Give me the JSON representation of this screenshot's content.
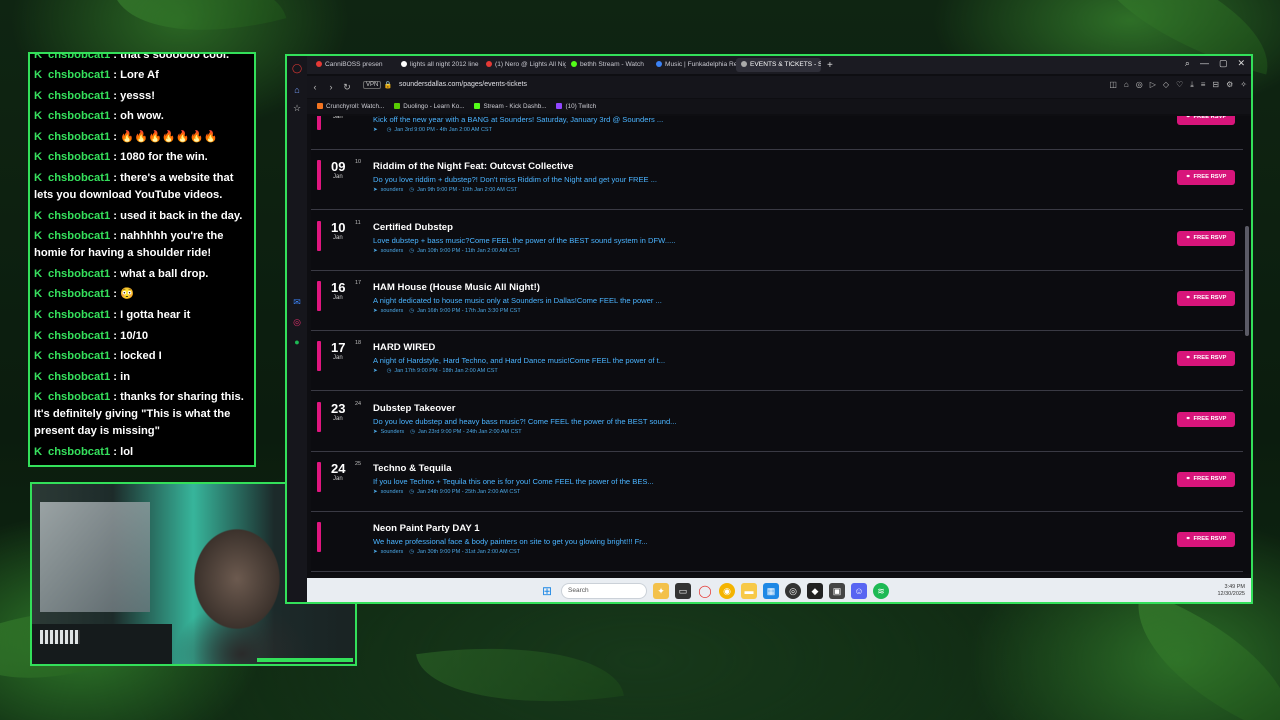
{
  "chat": {
    "messages": [
      {
        "user": "chsbobcat1",
        "text": ": that's soooooo cool."
      },
      {
        "user": "chsbobcat1",
        "text": ": Lore Af"
      },
      {
        "user": "chsbobcat1",
        "text": ": yesss!"
      },
      {
        "user": "chsbobcat1",
        "text": ": oh wow."
      },
      {
        "user": "chsbobcat1",
        "text": ": 🔥🔥🔥🔥🔥🔥🔥"
      },
      {
        "user": "chsbobcat1",
        "text": ": 1080 for the win."
      },
      {
        "user": "chsbobcat1",
        "text": ": there's a website that lets you download YouTube videos."
      },
      {
        "user": "chsbobcat1",
        "text": ": used it back in the day."
      },
      {
        "user": "chsbobcat1",
        "text": ": nahhhhh you're the homie for having a shoulder ride!"
      },
      {
        "user": "chsbobcat1",
        "text": ": what a ball drop."
      },
      {
        "user": "chsbobcat1",
        "text": ": 😳"
      },
      {
        "user": "chsbobcat1",
        "text": ": I gotta hear it"
      },
      {
        "user": "chsbobcat1",
        "text": ": 10/10"
      },
      {
        "user": "chsbobcat1",
        "text": ": locked I"
      },
      {
        "user": "chsbobcat1",
        "text": ": in"
      },
      {
        "user": "chsbobcat1",
        "text": ": thanks for sharing this. It's definitely giving \"This is what the present day is missing\""
      },
      {
        "user": "chsbobcat1",
        "text": ": lol"
      }
    ],
    "badge_glyph": "K"
  },
  "browser": {
    "tabs": [
      {
        "label": "CanniBOSS presen",
        "color": "#e53935"
      },
      {
        "label": "lights all night 2012 line",
        "color": "#ffffff"
      },
      {
        "label": "(1) Nero @ Lights All Nig",
        "color": "#e53935"
      },
      {
        "label": "bethh Stream - Watch",
        "color": "#53fc18"
      },
      {
        "label": "Music | Funkadelphia Rec",
        "color": "#3b82f6"
      },
      {
        "label": "EVENTS & TICKETS - Sou",
        "color": "#aaaaaa",
        "active": true
      }
    ],
    "new_tab": "+",
    "url": "soundersdallas.com/pages/events-tickets",
    "vpn": "VPN",
    "bookmarks": [
      {
        "label": "Crunchyroll: Watch...",
        "color": "#f47521"
      },
      {
        "label": "Duolingo - Learn Ko...",
        "color": "#58cc02"
      },
      {
        "label": "Stream - Kick Dashb...",
        "color": "#53fc18"
      },
      {
        "label": "(10) Twitch",
        "color": "#9146ff"
      }
    ],
    "taskbar": {
      "search_placeholder": "Search",
      "time": "3:49 PM",
      "date": "12/30/2025"
    }
  },
  "events": [
    {
      "day": "",
      "day2": "",
      "mon": "Jan",
      "title": "",
      "desc": "Kick off the new year with a BANG at Sounders! Saturday, January 3rd @ Sounders ...",
      "meta": "Jan 3rd 9:00 PM - 4th Jan 2:00 AM CST",
      "venue": "",
      "rsvp": "FREE RSVP"
    },
    {
      "day": "09",
      "day2": "10",
      "mon": "Jan",
      "title": "Riddim of the Night Feat: Outcvst Collective",
      "desc": "Do you love riddim + dubstep?! Don't miss Riddim of the Night and get your FREE ...",
      "meta": "Jan 9th 9:00 PM - 10th Jan 2:00 AM CST",
      "venue": "sounders",
      "rsvp": "FREE RSVP"
    },
    {
      "day": "10",
      "day2": "11",
      "mon": "Jan",
      "title": "Certified Dubstep",
      "desc": "Love dubstep + bass music?Come FEEL the power of the BEST sound system in DFW.....",
      "meta": "Jan 10th 9:00 PM - 11th Jan 2:00 AM CST",
      "venue": "sounders",
      "rsvp": "FREE RSVP"
    },
    {
      "day": "16",
      "day2": "17",
      "mon": "Jan",
      "title": "HAM House (House Music All Night!)",
      "desc": "A night dedicated to house music only at Sounders in Dallas!Come FEEL the power ...",
      "meta": "Jan 16th 9:00 PM - 17th Jan 3:30 PM CST",
      "venue": "sounders",
      "rsvp": "FREE RSVP"
    },
    {
      "day": "17",
      "day2": "18",
      "mon": "Jan",
      "title": "HARD WIRED",
      "desc": "A night of Hardstyle, Hard Techno, and Hard Dance music!Come FEEL the power of t...",
      "meta": "Jan 17th 9:00 PM - 18th Jan 2:00 AM CST",
      "venue": "",
      "rsvp": "FREE RSVP"
    },
    {
      "day": "23",
      "day2": "24",
      "mon": "Jan",
      "title": "Dubstep Takeover",
      "desc": "Do you love dubstep and heavy bass music?! Come FEEL the power of the BEST sound...",
      "meta": "Jan 23rd 9:00 PM - 24th Jan 2:00 AM CST",
      "venue": "Sounders",
      "rsvp": "FREE RSVP"
    },
    {
      "day": "24",
      "day2": "25",
      "mon": "Jan",
      "title": "Techno & Tequila",
      "desc": "If you love Techno + Tequila this one is for you! Come FEEL the power of the BES...",
      "meta": "Jan 24th 9:00 PM - 25th Jan 2:00 AM CST",
      "venue": "sounders",
      "rsvp": "FREE RSVP"
    },
    {
      "day": "",
      "day2": "",
      "mon": "",
      "title": "Neon Paint Party DAY 1",
      "desc": "We have professional face & body painters on site to get you glowing bright!!! Fr...",
      "meta": "Jan 30th 9:00 PM - 31st Jan 2:00 AM CST",
      "venue": "sounders",
      "rsvp": "FREE RSVP"
    }
  ],
  "colors": {
    "accent_green": "#33e05a",
    "rsvp_pink": "#d8157b",
    "link_blue": "#4bb4ff"
  }
}
